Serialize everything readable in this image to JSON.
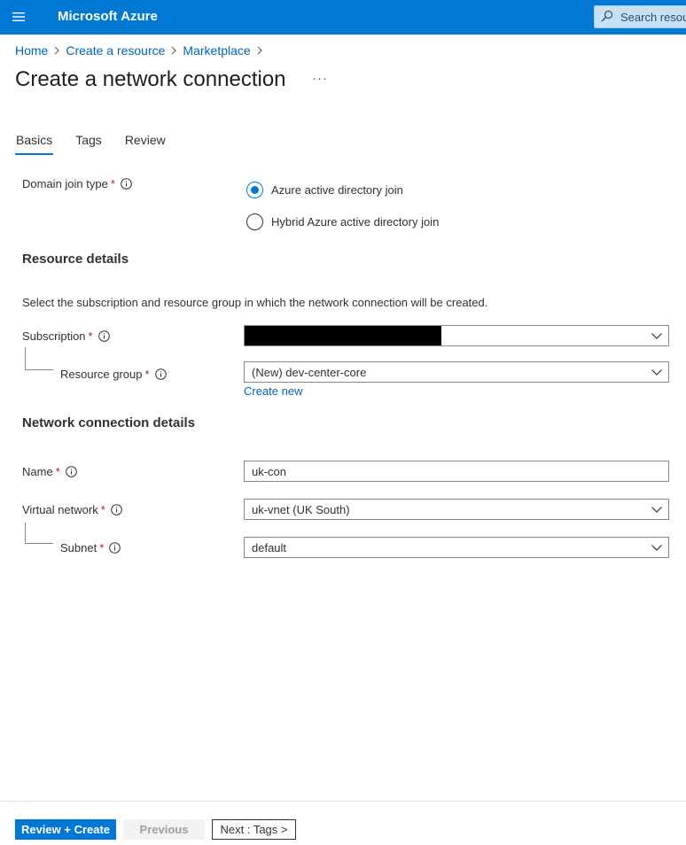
{
  "header": {
    "brand": "Microsoft Azure",
    "search_placeholder": "Search resou"
  },
  "breadcrumb": [
    "Home",
    "Create a resource",
    "Marketplace"
  ],
  "page": {
    "title": "Create a network connection",
    "more": "···"
  },
  "tabs": [
    {
      "label": "Basics",
      "active": true
    },
    {
      "label": "Tags",
      "active": false
    },
    {
      "label": "Review",
      "active": false
    }
  ],
  "form": {
    "domain_join_label": "Domain join type",
    "required_mark": "*",
    "domain_options": [
      {
        "label": "Azure active directory join",
        "selected": true
      },
      {
        "label": "Hybrid Azure active directory join",
        "selected": false
      }
    ],
    "resource_details_title": "Resource details",
    "resource_details_desc": "Select the subscription and resource group in which the network connection will be created.",
    "subscription_label": "Subscription",
    "subscription_value": "",
    "resource_group_label": "Resource group",
    "resource_group_value": "(New) dev-center-core",
    "create_new_link": "Create new",
    "network_details_title": "Network connection details",
    "name_label": "Name",
    "name_value": "uk-con",
    "vnet_label": "Virtual network",
    "vnet_value": "uk-vnet (UK South)",
    "subnet_label": "Subnet",
    "subnet_value": "default"
  },
  "footer": {
    "review_create": "Review + Create",
    "previous": "Previous",
    "next": "Next : Tags >"
  },
  "colors": {
    "accent": "#0078d4",
    "link": "#0065b3",
    "required": "#a4262c"
  }
}
